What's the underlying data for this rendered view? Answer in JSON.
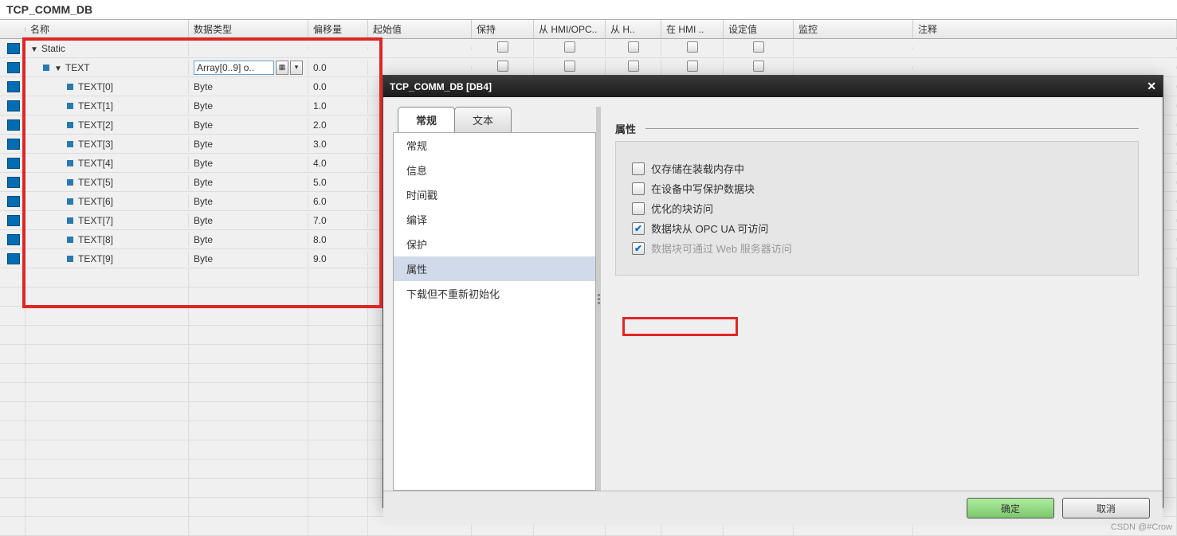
{
  "window": {
    "title": "TCP_COMM_DB"
  },
  "columns": {
    "name": "名称",
    "type": "数据类型",
    "offset": "偏移量",
    "start": "起始值",
    "keep": "保持",
    "hmi1": "从 HMI/OPC..",
    "hmi2": "从 H..",
    "hmi3": "在 HMI ..",
    "set": "设定值",
    "monitor": "监控",
    "comment": "注释"
  },
  "tree": {
    "root": "Static",
    "array": {
      "name": "TEXT",
      "type": "Array[0..9] o..",
      "offset": "0.0"
    },
    "items": [
      {
        "name": "TEXT[0]",
        "type": "Byte",
        "offset": "0.0"
      },
      {
        "name": "TEXT[1]",
        "type": "Byte",
        "offset": "1.0"
      },
      {
        "name": "TEXT[2]",
        "type": "Byte",
        "offset": "2.0"
      },
      {
        "name": "TEXT[3]",
        "type": "Byte",
        "offset": "3.0"
      },
      {
        "name": "TEXT[4]",
        "type": "Byte",
        "offset": "4.0"
      },
      {
        "name": "TEXT[5]",
        "type": "Byte",
        "offset": "5.0"
      },
      {
        "name": "TEXT[6]",
        "type": "Byte",
        "offset": "6.0"
      },
      {
        "name": "TEXT[7]",
        "type": "Byte",
        "offset": "7.0"
      },
      {
        "name": "TEXT[8]",
        "type": "Byte",
        "offset": "8.0"
      },
      {
        "name": "TEXT[9]",
        "type": "Byte",
        "offset": "9.0"
      }
    ]
  },
  "dialog": {
    "title": "TCP_COMM_DB [DB4]",
    "tabs": {
      "general": "常规",
      "text": "文本"
    },
    "nav": [
      "常规",
      "信息",
      "时间戳",
      "编译",
      "保护",
      "属性",
      "下载但不重新初始化"
    ],
    "nav_selected": "属性",
    "attr_heading": "属性",
    "options": [
      {
        "label": "仅存储在装载内存中",
        "checked": false,
        "disabled": false
      },
      {
        "label": "在设备中写保护数据块",
        "checked": false,
        "disabled": false
      },
      {
        "label": "优化的块访问",
        "checked": false,
        "disabled": false
      },
      {
        "label": "数据块从 OPC UA 可访问",
        "checked": true,
        "disabled": false
      },
      {
        "label": "数据块可通过 Web 服务器访问",
        "checked": true,
        "disabled": true
      }
    ],
    "ok": "确定",
    "cancel": "取消"
  },
  "watermark": "CSDN @#Crow"
}
